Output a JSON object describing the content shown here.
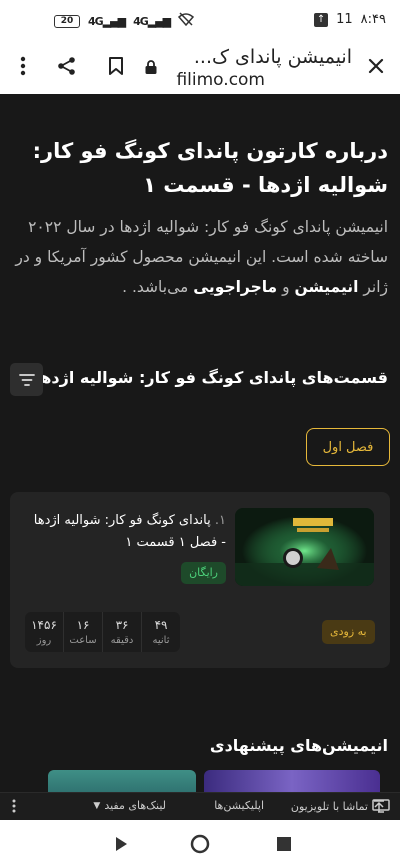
{
  "status": {
    "time": "۸:۴۹",
    "battery": "20",
    "net1": "4G",
    "net2": "4G",
    "notif_count": "11"
  },
  "browser": {
    "title": "انیمیشن پاندای ک...",
    "domain": "filimo.com"
  },
  "page": {
    "title": "درباره کارتون پاندای کونگ فو کار: شوالیه اژدها - قسمت ۱",
    "desc_pre": "انیمیشن پاندای کونگ فو کار: شوالیه اژدها در سال ۲۰۲۲ ساخته شده است. این انیمیشن محصول کشور آمریکا و در ژانر ",
    "genre1": "انیمیشن",
    "desc_and": " و ",
    "genre2": "ماجراجویی",
    "desc_post": " می‌باشد. ."
  },
  "episodes": {
    "heading": "قسمت‌های پاندای کونگ فو کار: شوالیه اژدها",
    "season_label": "فصل اول",
    "card": {
      "num": "۱.",
      "title": "پاندای کونگ فو کار: شوالیه اژدها - فصل ۱ قسمت ۱",
      "badge": "رایگان",
      "soon": "به زودی",
      "countdown": [
        {
          "value": "۴۹",
          "label": "ثانیه"
        },
        {
          "value": "۳۶",
          "label": "دقیقه"
        },
        {
          "value": "۱۶",
          "label": "ساعت"
        },
        {
          "value": "۱۴۵۶",
          "label": "روز"
        }
      ]
    }
  },
  "recommended": {
    "heading": "انیمیشن‌های پیشنهادی"
  },
  "linkbar": {
    "tv": "تماشا با تلویزیون",
    "apps": "اپلیکیشن‌ها",
    "links": "لینک‌های مفید"
  },
  "colors": {
    "accent": "#e6b83a",
    "free": "#4cd07a",
    "bg": "#181818"
  }
}
